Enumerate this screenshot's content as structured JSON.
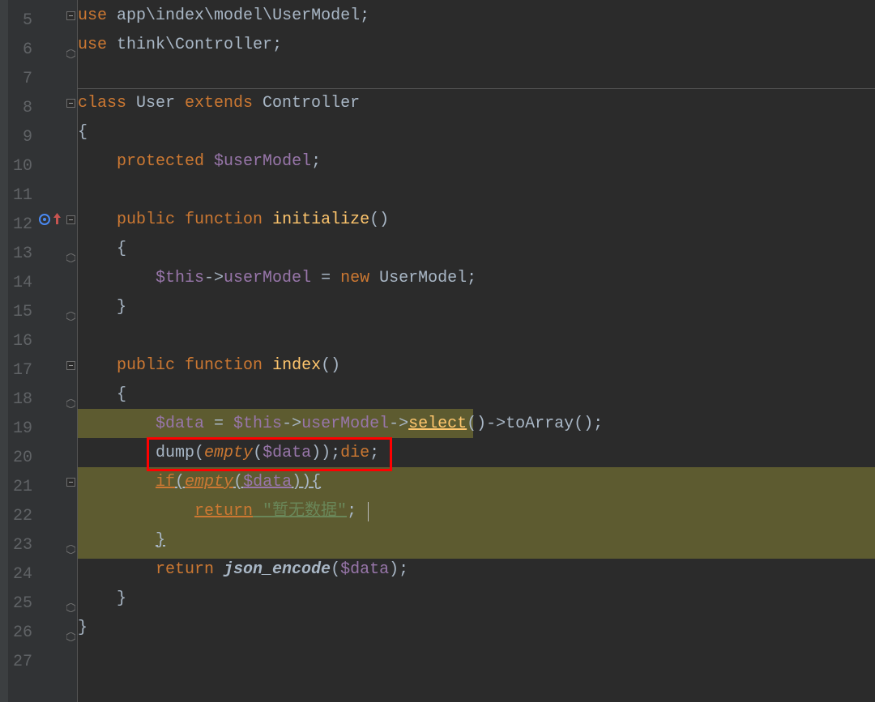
{
  "gutter": {
    "start": 5,
    "end": 27
  },
  "code": {
    "l5": {
      "kw1": "use",
      "p1": " app\\index\\model\\",
      "cls": "UserModel",
      "p2": ";"
    },
    "l6": {
      "kw1": "use",
      "p1": " think\\",
      "cls": "Controller",
      "p2": ";"
    },
    "l7": "",
    "l8": {
      "kw1": "class",
      "name": " User ",
      "kw2": "extends",
      "ext": " Controller"
    },
    "l9": "{",
    "l10": {
      "kw": "protected",
      "var": " $userModel",
      "p": ";"
    },
    "l11": "",
    "l12": {
      "kw1": "public",
      "kw2": " function",
      "name": " initialize",
      "paren": "()"
    },
    "l13": "{",
    "l14": {
      "var1": "$this",
      "arrow": "->",
      "prop": "userModel",
      "eq": " = ",
      "kw": "new",
      "cls": " UserModel",
      "p": ";"
    },
    "l15": "}",
    "l16": "",
    "l17": {
      "kw1": "public",
      "kw2": " function",
      "name": " index",
      "paren": "()"
    },
    "l18": "{",
    "l19": {
      "var": "$data",
      "eq": " = ",
      "this": "$this",
      "arrow1": "->",
      "prop": "userModel",
      "arrow2": "->",
      "m1": "select",
      "p1": "()",
      "arrow3": "->",
      "m2": "toArray",
      "p2": "();"
    },
    "l20": {
      "fn1": "dump",
      "p1": "(",
      "fn2": "empty",
      "p2": "(",
      "var": "$data",
      "p3": "));",
      "kw": "die",
      "p4": ";"
    },
    "l21": {
      "kw": "if",
      "p1": "(",
      "fn": "empty",
      "p2": "(",
      "var": "$data",
      "p3": ")){"
    },
    "l22": {
      "kw": "return",
      "str": " \"暂无数据\"",
      "p": ";"
    },
    "l23": "}",
    "l24": {
      "kw": "return",
      "fn": " json_encode",
      "p1": "(",
      "var": "$data",
      "p2": ");"
    },
    "l25": "}",
    "l26": "}",
    "l27": ""
  }
}
